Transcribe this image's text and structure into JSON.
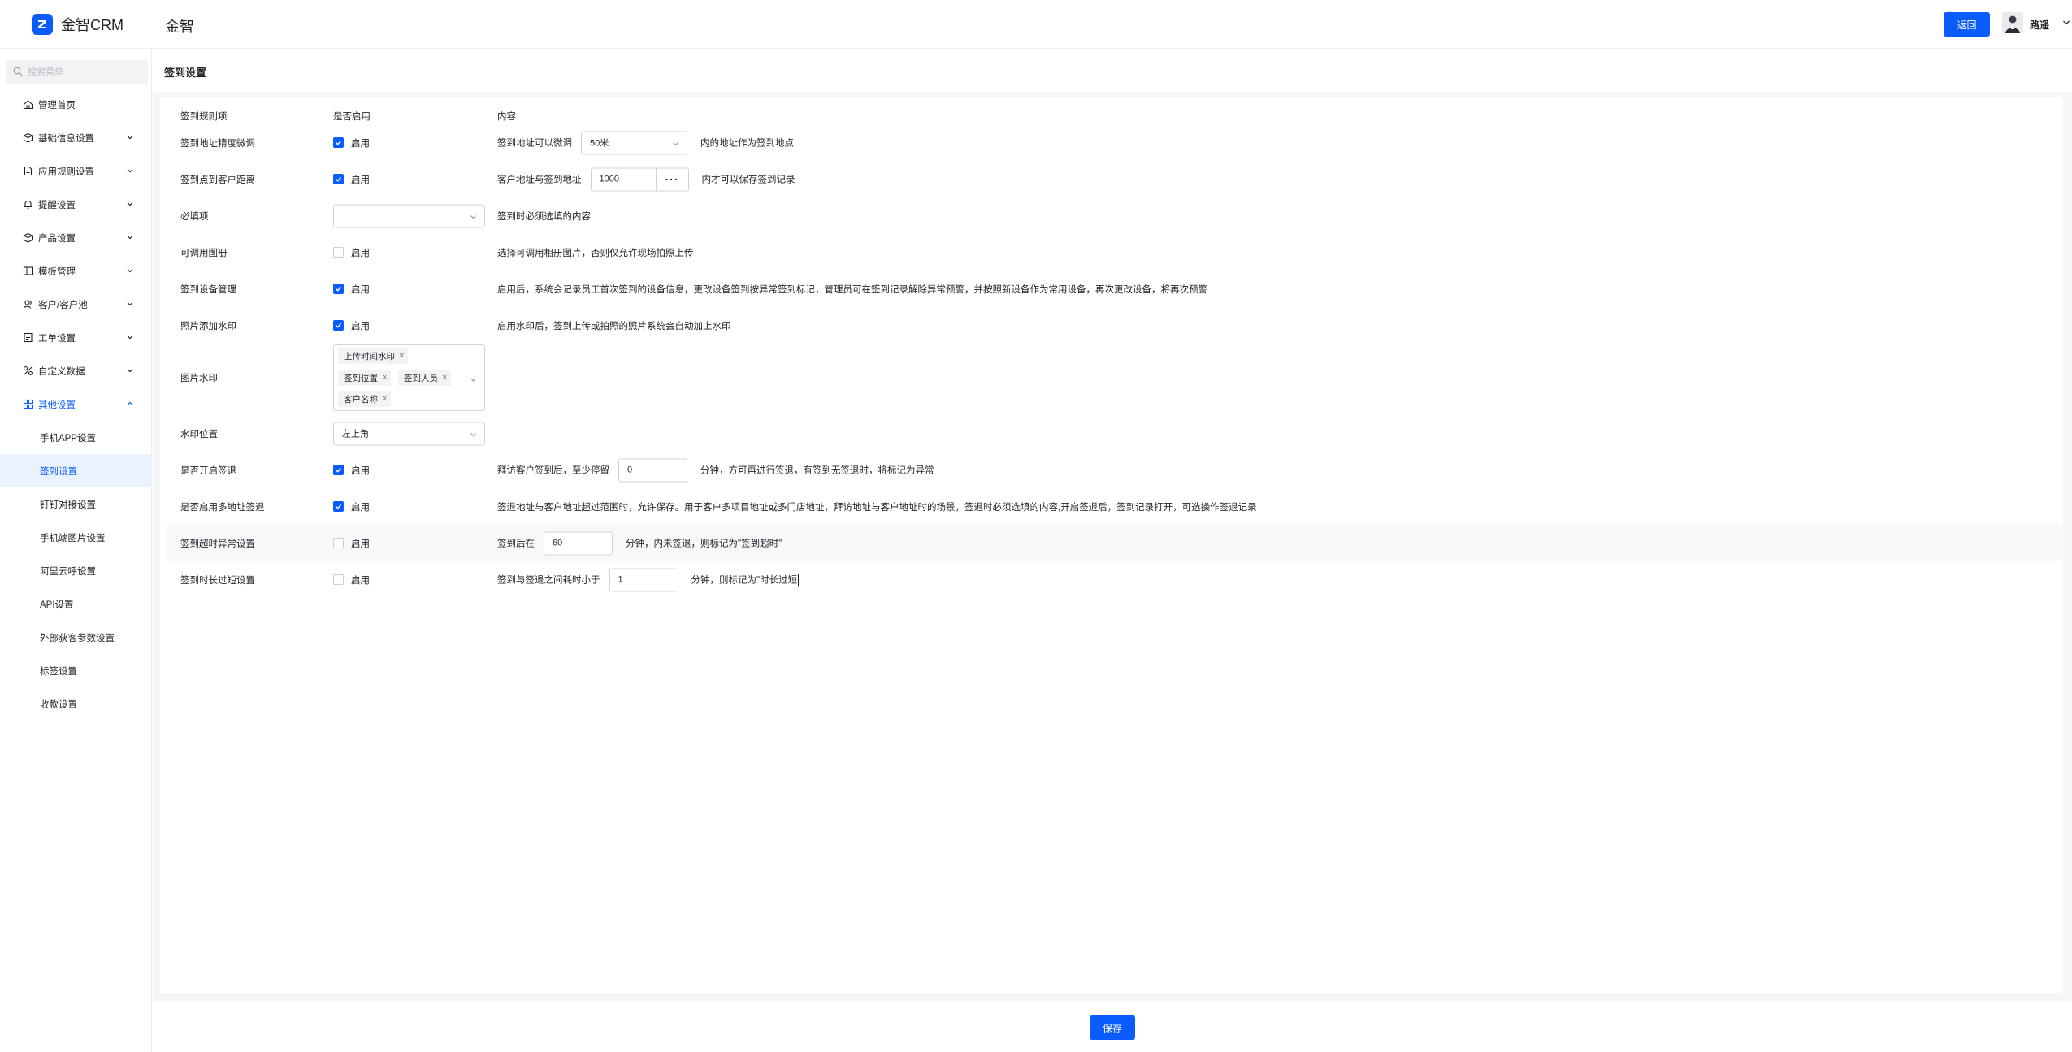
{
  "header": {
    "logo_text": "金智CRM",
    "app_title": "金智",
    "back_label": "返回",
    "user_name": "路遥"
  },
  "sidebar": {
    "search_placeholder": "搜索菜单",
    "items": [
      {
        "label": "管理首页",
        "icon": "home-icon"
      },
      {
        "label": "基础信息设置",
        "icon": "cube-icon"
      },
      {
        "label": "应用规则设置",
        "icon": "document-icon"
      },
      {
        "label": "提醒设置",
        "icon": "bell-icon"
      },
      {
        "label": "产品设置",
        "icon": "cube-icon"
      },
      {
        "label": "模板管理",
        "icon": "template-icon"
      },
      {
        "label": "客户/客户池",
        "icon": "customer-icon"
      },
      {
        "label": "工单设置",
        "icon": "ticket-icon"
      },
      {
        "label": "自定义数据",
        "icon": "custom-data-icon"
      },
      {
        "label": "其他设置",
        "icon": "grid-icon"
      }
    ],
    "sub_items": [
      "手机APP设置",
      "签到设置",
      "钉钉对接设置",
      "手机端图片设置",
      "阿里云呼设置",
      "API设置",
      "外部获客参数设置",
      "标签设置",
      "收款设置"
    ]
  },
  "page": {
    "title": "签到设置",
    "save_label": "保存"
  },
  "columns": {
    "name": "签到规则项",
    "enabled": "是否启用",
    "content": "内容"
  },
  "enable_label": "启用",
  "rows": {
    "r1": {
      "name": "签到地址精度微调",
      "checked": true,
      "pre": "签到地址可以微调",
      "select_value": "50米",
      "post": "内的地址作为签到地点"
    },
    "r2": {
      "name": "签到点到客户距离",
      "checked": true,
      "pre": "客户地址与签到地址",
      "input_value": "1000",
      "post": "内才可以保存签到记录"
    },
    "r3": {
      "name": "必填项",
      "select_value": "",
      "content": "签到时必须选填的内容"
    },
    "r4": {
      "name": "可调用图册",
      "checked": false,
      "content": "选择可调用相册图片，否则仅允许现场拍照上传"
    },
    "r5": {
      "name": "签到设备管理",
      "checked": true,
      "content": "启用后，系统会记录员工首次签到的设备信息，更改设备签到按异常签到标记，管理员可在签到记录解除异常预警，并按照新设备作为常用设备，再次更改设备，将再次预警"
    },
    "r6": {
      "name": "照片添加水印",
      "checked": true,
      "content": "启用水印后，签到上传或拍照的照片系统会自动加上水印"
    },
    "r7": {
      "name": "图片水印",
      "tags": [
        "上传时间水印",
        "签到位置",
        "签到人员",
        "客户名称"
      ]
    },
    "r8": {
      "name": "水印位置",
      "select_value": "左上角"
    },
    "r9": {
      "name": "是否开启签退",
      "checked": true,
      "pre": "拜访客户签到后，至少停留",
      "input_value": "0",
      "post": "分钟，方可再进行签退，有签到无签退时，将标记为异常"
    },
    "r10": {
      "name": "是否启用多地址签退",
      "checked": true,
      "content": "签退地址与客户地址超过范围时，允许保存。用于客户多项目地址或多门店地址，拜访地址与客户地址时的场景，签退时必须选填的内容,开启签退后，签到记录打开，可选操作签退记录"
    },
    "r11": {
      "name": "签到超时异常设置",
      "checked": false,
      "pre": "签到后在",
      "input_value": "60",
      "post": "分钟，内未签退，则标记为\"签到超时\""
    },
    "r12": {
      "name": "签到时长过短设置",
      "checked": false,
      "pre": "签到与签退之间耗时小于",
      "input_value": "1",
      "post": "分钟，则标记为\"时长过短"
    }
  },
  "colors": {
    "primary": "#0a5cff",
    "background": "#f5f6f8",
    "highlight_row": "#f7f8fa"
  }
}
